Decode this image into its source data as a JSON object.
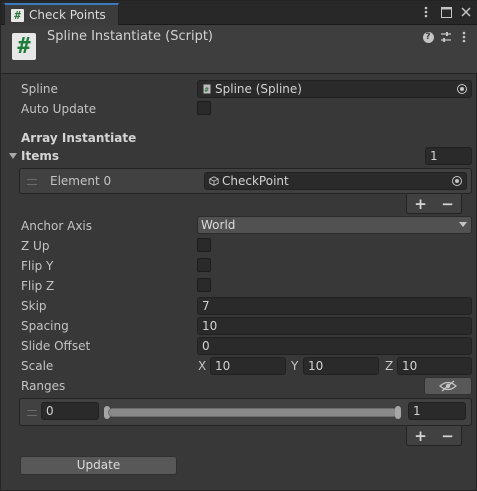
{
  "tab": {
    "title": "Check Points",
    "icon": "script-hash-icon"
  },
  "header": {
    "title": "Spline Instantiate (Script)",
    "icon": "script-hash-icon",
    "icon_glyph": "#"
  },
  "fields": {
    "spline_label": "Spline",
    "spline_value": "Spline (Spline)",
    "auto_update_label": "Auto Update",
    "auto_update_checked": false,
    "array_header": "Array Instantiate",
    "items_label": "Items",
    "items_count": "1",
    "element0_label": "Element 0",
    "element0_value": "CheckPoint",
    "anchor_axis_label": "Anchor Axis",
    "anchor_axis_value": "World",
    "z_up_label": "Z Up",
    "flip_y_label": "Flip Y",
    "flip_z_label": "Flip Z",
    "skip_label": "Skip",
    "skip_value": "7",
    "spacing_label": "Spacing",
    "spacing_value": "10",
    "slide_offset_label": "Slide Offset",
    "slide_offset_value": "0",
    "scale_label": "Scale",
    "scale_x_label": "X",
    "scale_x": "10",
    "scale_y_label": "Y",
    "scale_y": "10",
    "scale_z_label": "Z",
    "scale_z": "10",
    "ranges_label": "Ranges",
    "range_min": "0",
    "range_max": "1",
    "update_button": "Update",
    "plus": "+",
    "minus": "−"
  },
  "colors": {
    "tab_accent": "#3a79bb",
    "script_icon_bg": "#e7e7e7",
    "script_icon_fg": "#1e7d3a"
  }
}
